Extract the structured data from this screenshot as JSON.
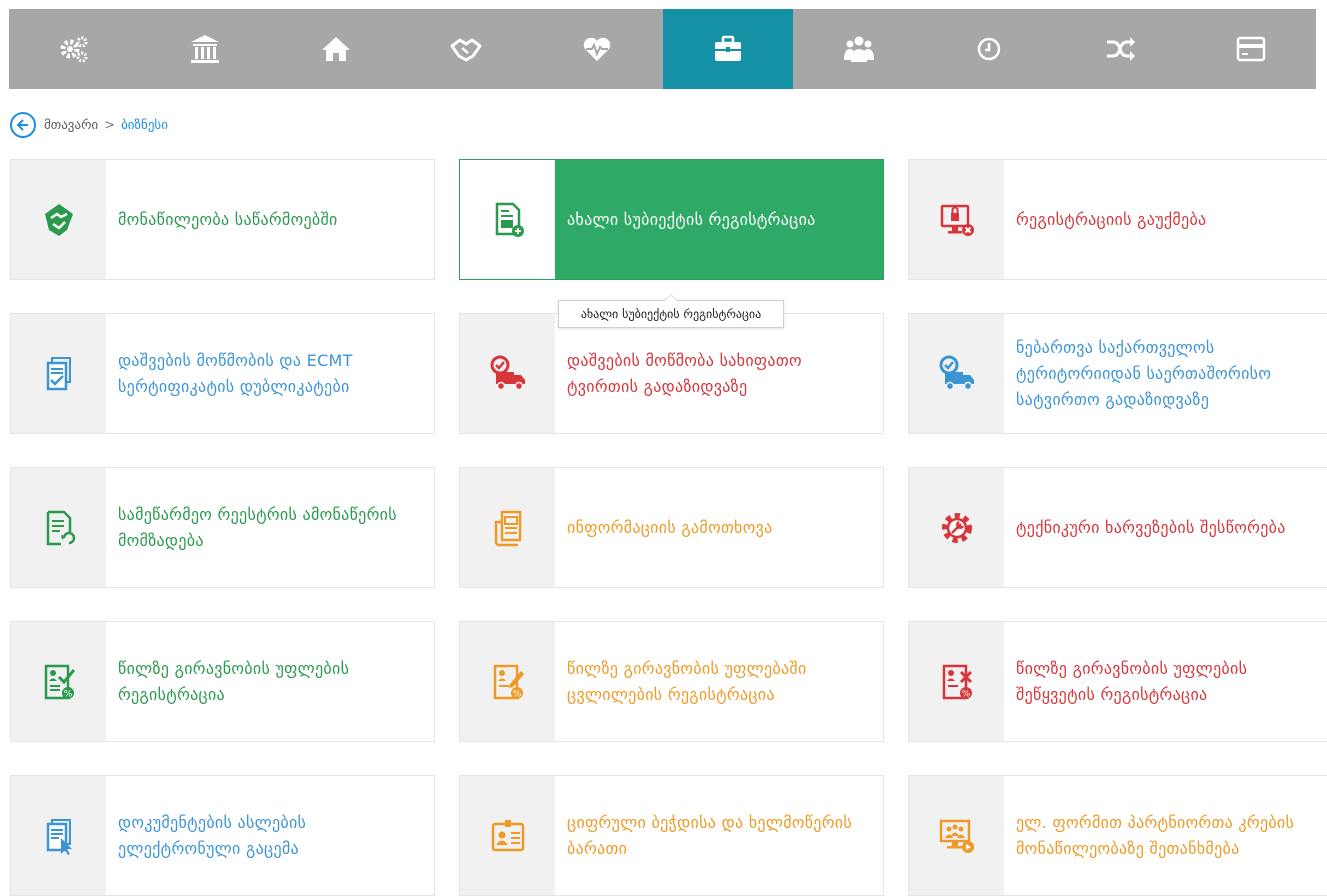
{
  "colors": {
    "topbar_bg": "#a7a7a7",
    "topbar_active": "#1591a5",
    "active_card": "#2ea966",
    "green": "#2a9a4d",
    "blue": "#3b95d4",
    "red": "#d6363a",
    "orange": "#ef9a26"
  },
  "topbar": {
    "tabs": [
      {
        "icon": "gears-icon",
        "active": false
      },
      {
        "icon": "bank-icon",
        "active": false
      },
      {
        "icon": "home-icon",
        "active": false
      },
      {
        "icon": "handshake-icon",
        "active": false
      },
      {
        "icon": "heartbeat-icon",
        "active": false
      },
      {
        "icon": "briefcase-icon",
        "active": true
      },
      {
        "icon": "people-icon",
        "active": false
      },
      {
        "icon": "clock-icon",
        "active": false
      },
      {
        "icon": "shuffle-icon",
        "active": false
      },
      {
        "icon": "card-icon",
        "active": false
      }
    ]
  },
  "breadcrumb": {
    "back_icon": "arrow-left-icon",
    "home": "მთავარი",
    "separator": ">",
    "current": "ბიზნესი"
  },
  "tooltip": "ახალი სუბიექტის რეგისტრაცია",
  "cards": [
    {
      "label": "მონაწილეობა საწარმოებში",
      "icon": "handshake-icon",
      "color": "green"
    },
    {
      "label": "ახალი სუბიექტის რეგისტრაცია",
      "icon": "document-add-icon",
      "color": "white"
    },
    {
      "label": "რეგისტრაციის გაუქმება",
      "icon": "monitor-lock-icon",
      "color": "red"
    },
    {
      "label": "დაშვების მოწმობის და ECMT სერტიფიკატის დუბლიკატები",
      "icon": "documents-check-icon",
      "color": "blue"
    },
    {
      "label": "დაშვების მოწმობა სახიფათო ტვირთის გადაზიდვაზე",
      "icon": "truck-check-icon",
      "color": "red"
    },
    {
      "label": "ნებართვა საქართველოს ტერიტორიიდან საერთაშორისო სატვირთო გადაზიდვაზე",
      "icon": "truck-check-icon",
      "color": "blue"
    },
    {
      "label": "სამეწარმეო რეესტრის ამონაწერის მომზადება",
      "icon": "document-refresh-icon",
      "color": "green"
    },
    {
      "label": "ინფორმაციის გამოთხოვა",
      "icon": "document-stack-icon",
      "color": "orange"
    },
    {
      "label": "ტექნიკური ხარვეზების შესწორება",
      "icon": "gear-wrench-icon",
      "color": "red"
    },
    {
      "label": "წილზე გირავნობის უფლების რეგისტრაცია",
      "icon": "document-percent-check-icon",
      "color": "green"
    },
    {
      "label": "წილზე გირავნობის უფლებაში ცვლილების რეგისტრაცია",
      "icon": "document-percent-edit-icon",
      "color": "orange"
    },
    {
      "label": "წილზე გირავნობის უფლების შეწყვეტის რეგისტრაცია",
      "icon": "document-percent-cancel-icon",
      "color": "red"
    },
    {
      "label": "დოკუმენტების ასლების ელექტრონული გაცემა",
      "icon": "document-cursor-icon",
      "color": "blue"
    },
    {
      "label": "ციფრული ბეჭდისა და ხელმოწერის ბარათი",
      "icon": "id-card-icon",
      "color": "orange"
    },
    {
      "label": "ელ. ფორმით პარტნიორთა კრების მონაწილეობაზე შეთანხმება",
      "icon": "meeting-screen-icon",
      "color": "orange"
    }
  ]
}
